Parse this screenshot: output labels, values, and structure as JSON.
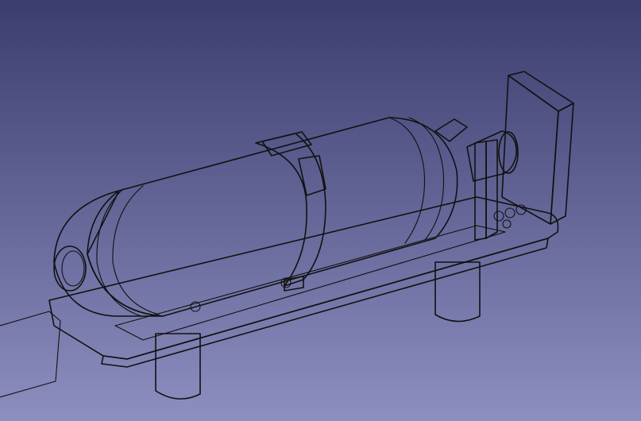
{
  "viewer": {
    "background_top": "#3b3d6e",
    "background_bottom": "#8d8fc0",
    "model_color": "#c8c8c8",
    "edge_color": "#111111",
    "model_description_icon": "gas-cylinder-on-mount-bracket-icon"
  }
}
